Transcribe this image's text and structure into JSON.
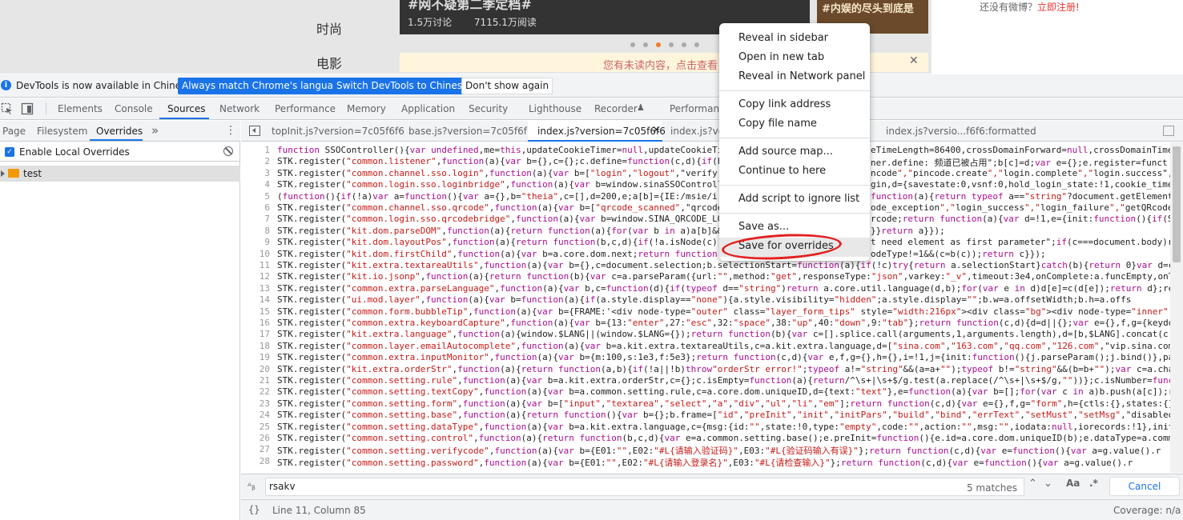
{
  "webpage": {
    "categories": [
      "时尚",
      "电影"
    ],
    "banner_title": "#网不疑第二季定档#",
    "banner_stats": [
      "1.5万讨论",
      "7115.1万阅读"
    ],
    "side_title": "#内娱的尽头到底是",
    "notice": "您有未读内容，点击查看",
    "right_text": "还没有微博？",
    "right_link": "立即注册!"
  },
  "infobar": {
    "text": "DevTools is now available in Chinese!",
    "btn_match": "Always match Chrome's language",
    "btn_switch": "Switch DevTools to Chinese",
    "btn_dismiss": "Don't show again"
  },
  "main_tabs": [
    "Elements",
    "Console",
    "Sources",
    "Network",
    "Performance",
    "Memory",
    "Application",
    "Security",
    "Lighthouse",
    "Recorder",
    "Performance"
  ],
  "left_tabs": [
    "Page",
    "Filesystem",
    "Overrides"
  ],
  "left_more": "»",
  "left_menu": "⋮",
  "enable_overrides": "Enable Local Overrides",
  "tree_folder": "test",
  "editor_tabs": [
    "topInit.js?version=7c05f6f6",
    "base.js?version=7c05f6f6",
    "index.js?version=7c05f6f6",
    "index.js?ver",
    "index.js?versio...f6f6:formatted"
  ],
  "editor_tab_close": "×",
  "code_lines": [
    "function SSOController(){var undefined,me=this,updateCookieTimer=null,updateCookieTi",
    "STK.register(\"common.listener\",function(a){var b={},c={};c.define=function(c,d){if(b",
    "STK.register(\"common.channel.sso.login\",function(a){var b=[\"login\",\"logout\",\"verify",
    "STK.register(\"common.login.sso.loginbridge\",function(a){var b=window.sinaSSOControll",
    "(function(){if(!a)var a=function(){var a={},b=\"theia\",c=[],d=200,e;a[b]={IE:/msie/i",
    "STK.register(\"common.channel.sso.qrcode\",function(a){var b=[\"qrcode_scanned\",\"qrcode",
    "STK.register(\"common.login.sso.qrcodebridge\",function(a){var b=window.SINA_QRCODE_LO",
    "STK.register(\"kit.dom.parseDOM\",function(a){return function(a){for(var b in a)a[b]&&",
    "STK.register(\"kit.dom.layoutPos\",function(a){return function(b,c,d){if(!a.isNode(c))",
    "STK.register(\"kit.dom.firstChild\",function(a){var b=a.core.dom.next;return function(",
    "STK.register(\"kit.extra.textareaUtils\",function(a){var b={},c=document.selection;b.selectionStart=function(a){if(!c)try{return a.selectionStart}catch(b){return 0}var d=c",
    "STK.register(\"kit.io.jsonp\",function(a){return function(b){var c=a.parseParam({url:\"\",method:\"get\",responseType:\"json\",varkey:\"_v\",timeout:3e4,onComplete:a.funcEmpty,onT",
    "STK.register(\"common.extra.parseLanguage\",function(a){var b,c=function(d){if(typeof d==\"string\")return a.core.util.language(d,b);for(var e in d)d[e]=c(d[e]);return d};ret",
    "STK.register(\"ui.mod.layer\",function(a){var b=function(a){if(a.style.display==\"none\"){a.style.visibility=\"hidden\";a.style.display=\"\";b.w=a.offsetWidth;b.h=a.offs",
    "STK.register(\"common.form.bubbleTip\",function(a){var b={FRAME:'<div node-type=\"outer\" class=\"layer_form_tips\" style=\"width:216px\"><div class=\"bg\"><div node-type=\"inner\"",
    "STK.register(\"common.extra.keyboardCapture\",function(a){var b={13:\"enter\",27:\"esc\",32:\"space\",38:\"up\",40:\"down\",9:\"tab\"};return function(c,d){d=d||{};var e={},f,g={keydo",
    "STK.register(\"kit.extra.language\",function(a){window.$LANG||(window.$LANG={});return function(b){var c=[].splice.call(arguments,1,arguments.length),d=[b,$LANG].concat(c",
    "STK.register(\"common.layer.emailAutocomplete\",function(a){var b=a.kit.extra.textareaUtils,c=a.kit.extra.language,d=[\"sina.com\",\"163.com\",\"qq.com\",\"126.com\",\"vip.sina.com",
    "STK.register(\"common.extra.inputMonitor\",function(a){var b={m:100,s:1e3,f:5e3};return function(c,d){var e,f,g={},h={},i=!1,j={init:function(){j.parseParam();j.bind()},par",
    "STK.register(\"kit.extra.orderStr\",function(a){return function(a,b){if(!a||!b)throw\"orderStr error!\";typeof a!=\"string\"&&(a=a+\"\");typeof b!=\"string\"&&(b=b+\"\");var c=a.cha",
    "STK.register(\"common.setting.rule\",function(a){var b=a.kit.extra.orderStr,c={};c.isEmpty=function(a){return/^\\s+|\\s+$/g.test(a.replace(/^\\s+|\\s+$/g,\"\"))};c.isNumber=function",
    "STK.register(\"common.setting.textCopy\",function(a){var b=a.common.setting.rule,c=a.core.dom.uniqueID,d={text:\"text\"},e=function(a){var b=[];for(var c in a)b.push(a[c]);r",
    "STK.register(\"common.setting.form\",function(a){var b=[\"input\",\"textarea\",\"select\",\"a\",\"div\",\"ul\",\"li\",\"em\"];return function(c,d){var e={},f,g=\"form\",h={ctls:{},states:{}",
    "STK.register(\"common.setting.base\",function(a){return function(){var b={};b.frame=[\"id\",\"preInit\",\"init\",\"initPars\",\"build\",\"bind\",\"errText\",\"setMust\",\"setMsg\",\"disabled",
    "STK.register(\"common.setting.dataType\",function(a){var b=a.kit.extra.language,c={msg:{id:\"\",state:!0,type:\"empty\",code:\"\",action:\"\",msg:\"\",iodata:null,iorecords:!1},init",
    "STK.register(\"common.setting.control\",function(a){return function(b,c,d){var e=a.common.setting.base();e.preInit=function(){e.id=a.core.dom.uniqueID(b);e.dataType=a.comm",
    "STK.register(\"common.setting.verifycode\",function(a){var b={E01:\"\",E02:\"#L{请输入验证码}\",E03:\"#L{验证码输入有误}\"};return function(c,d){var e=function(){var a=g.value().r",
    "STK.register(\"common.setting.password\",function(a){var b={E01:\"\",E02:\"#L{请输入登录名}\",E03:\"#L{请检查输入}\"};return function(c,d){var e=function(){var a=g.value().r"
  ],
  "code_right_fragments": [
    "eTimeLength=86400,crossDomainForward=null,crossDomainTime",
    "ner.define: 频道已被占用\";b[c]=d;var e={};e.register=funct",
    "ncode\",\"pincode.create\",\"login.complete\",\"login.success\",",
    "gin,d={savestate:0,vsnf:0,hold_login_state:!1,cookie_time",
    "function(a){return typeof a==\"string\"?document.getElement",
    "ode_exception\",\"login_success\",\"login_failure\",\"getQRcode",
    "rcode;return function(a){var d=!1,e={init:function(){if(S",
    "}}return a}});",
    "t need element as first parameter\";if(c===document.body)r",
    "odeType!=1&&(c=b(c));return c}});"
  ],
  "search": {
    "value": "rsakv",
    "count": "5 matches",
    "case_btn": "Aa",
    "regex_btn": ".*",
    "cancel": "Cancel"
  },
  "status": {
    "braces": "{}",
    "position": "Line 11, Column 85",
    "coverage": "Coverage: n/a"
  },
  "context_menu": {
    "groups": [
      [
        "Reveal in sidebar",
        "Open in new tab",
        "Reveal in Network panel"
      ],
      [
        "Copy link address",
        "Copy file name"
      ],
      [
        "Add source map...",
        "Continue to here"
      ],
      [
        "Add script to ignore list"
      ],
      [
        "Save as...",
        "Save for overrides"
      ]
    ],
    "highlighted": "Save for overrides"
  },
  "colors": {
    "accent": "#1a73e8",
    "annotation": "#e32020",
    "string": "#c41a16",
    "keyword": "#aa0d91"
  }
}
